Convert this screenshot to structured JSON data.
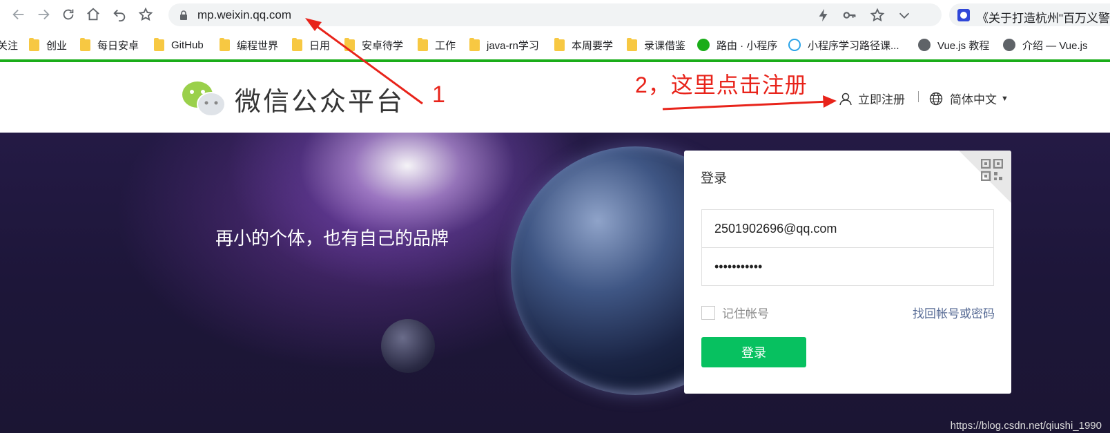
{
  "browser": {
    "url": "mp.weixin.qq.com",
    "side_tab_title": "《关于打造杭州\"百万义警",
    "bookmarks": [
      "关注",
      "创业",
      "每日安卓",
      "GitHub",
      "编程世界",
      "日用",
      "安卓待学",
      "工作",
      "java-rn学习",
      "本周要学",
      "录课借鉴",
      "路由 · 小程序",
      "小程序学习路径课...",
      "Vue.js 教程",
      "介绍 — Vue.js"
    ]
  },
  "header": {
    "site_title": "微信公众平台",
    "register_label": "立即注册",
    "language_label": "简体中文"
  },
  "banner": {
    "slogan": "再小的个体，也有自己的品牌",
    "watermark": "https://blog.csdn.net/qiushi_1990"
  },
  "login": {
    "title": "登录",
    "account_value": "2501902696@qq.com",
    "password_value": "•••••••••••",
    "remember_label": "记住帐号",
    "remember_checked": false,
    "forgot_label": "找回帐号或密码",
    "submit_label": "登录"
  },
  "annotations": {
    "label_1": "1",
    "label_2": "2，这里点击注册",
    "color": "#e8231a"
  },
  "colors": {
    "brand_green": "#07c160",
    "top_rule": "#1aad19",
    "link_blue": "#576b95"
  }
}
